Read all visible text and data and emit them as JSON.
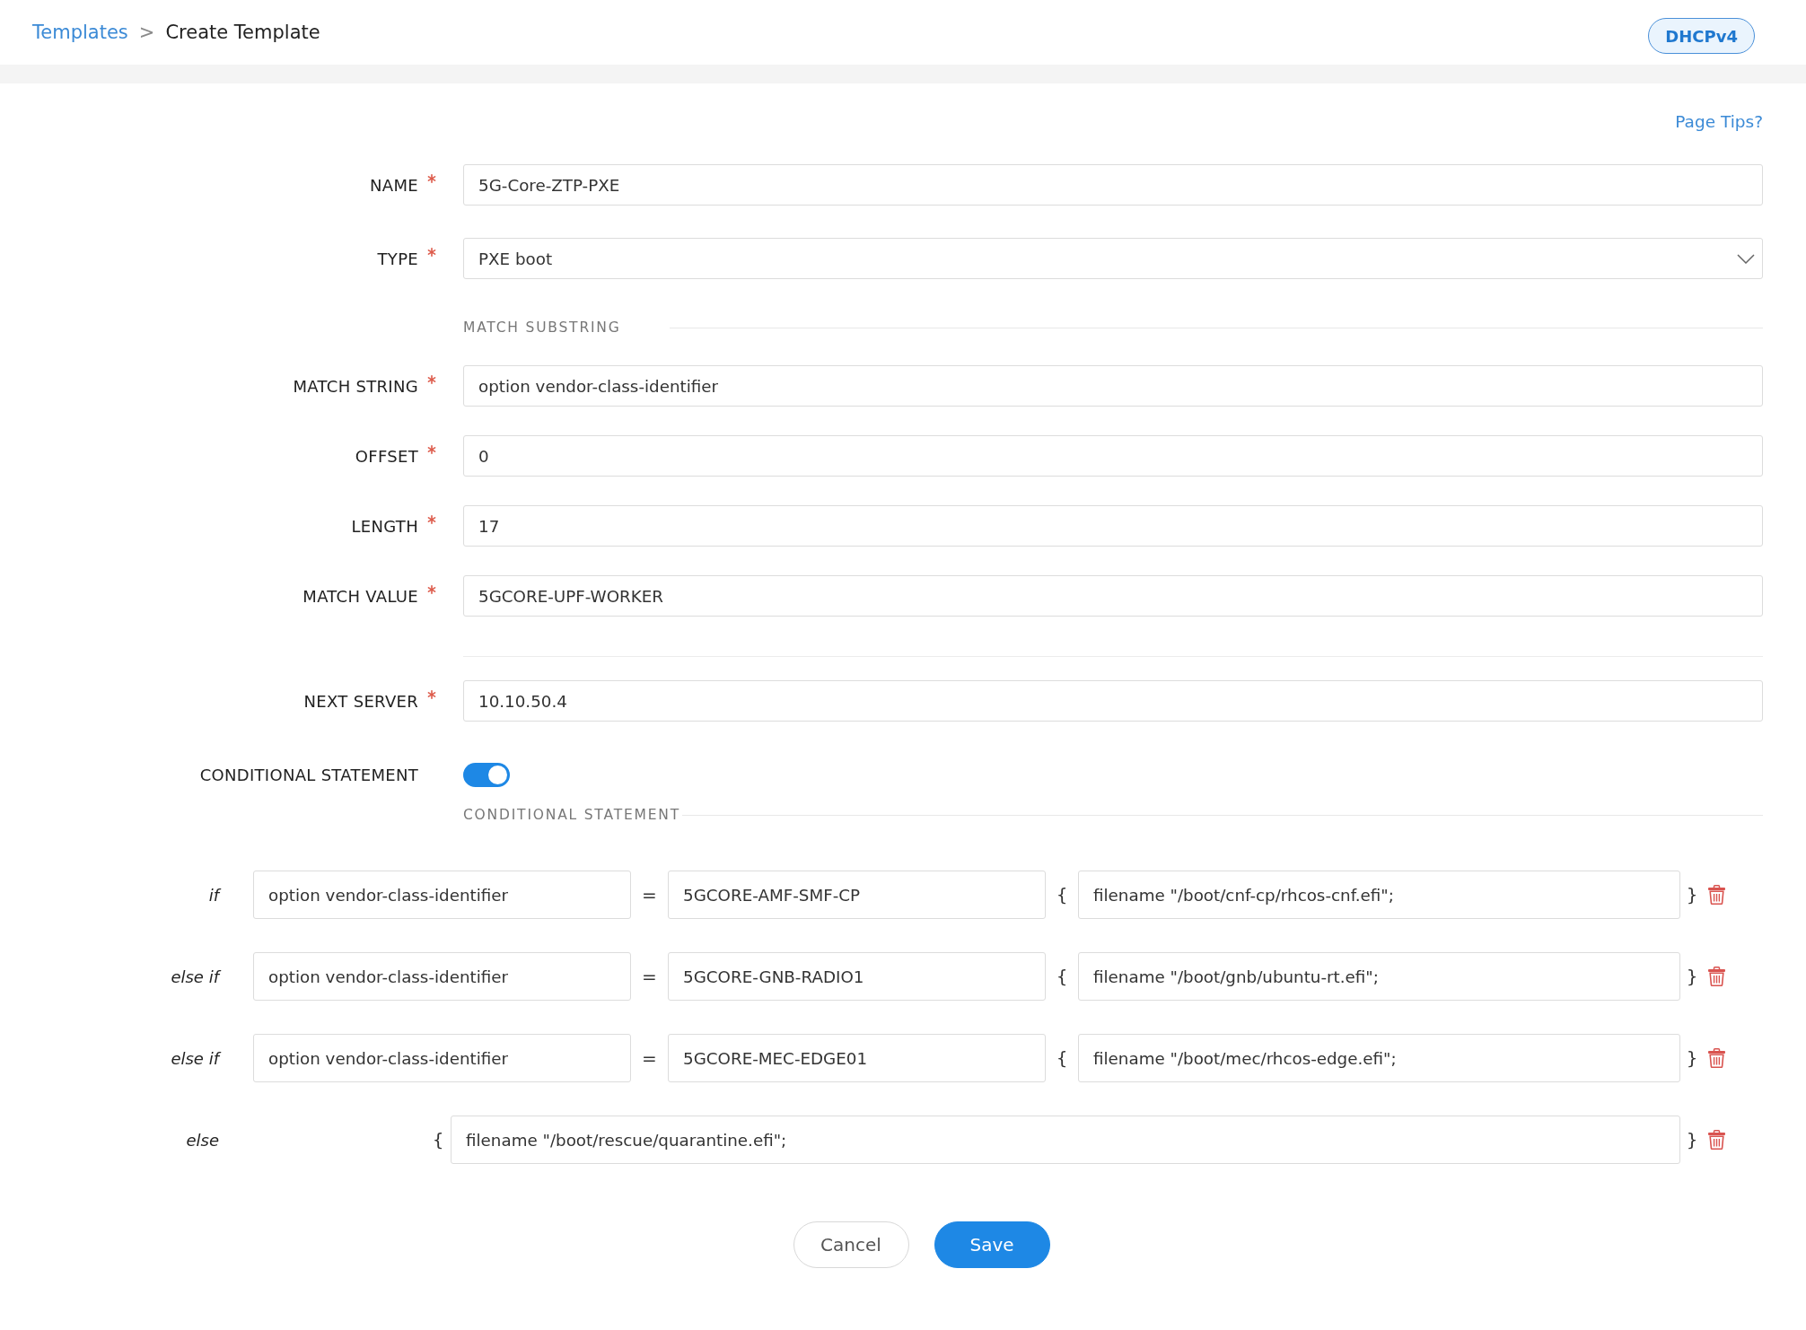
{
  "header": {
    "breadcrumb": [
      {
        "kind": "link",
        "label": "Templates"
      },
      {
        "kind": "separator",
        "label": ">"
      },
      {
        "kind": "current",
        "label": "Create Template"
      }
    ],
    "badge": "DHCPv4"
  },
  "page_tips": "Page Tips?",
  "form": {
    "rows": [
      {
        "kind": "text",
        "label": "NAME",
        "required": true,
        "value": "5G-Core-ZTP-PXE"
      },
      {
        "kind": "select",
        "label": "TYPE",
        "required": true,
        "value": "PXE boot"
      },
      {
        "kind": "section",
        "title": "MATCH SUBSTRING"
      },
      {
        "kind": "text",
        "label": "MATCH STRING",
        "required": true,
        "value": "option vendor-class-identifier"
      },
      {
        "kind": "text",
        "label": "OFFSET",
        "required": true,
        "value": "0"
      },
      {
        "kind": "text",
        "label": "LENGTH",
        "required": true,
        "value": "17"
      },
      {
        "kind": "text",
        "label": "MATCH VALUE",
        "required": true,
        "value": "5GCORE-UPF-WORKER"
      },
      {
        "kind": "divider"
      },
      {
        "kind": "text",
        "label": "NEXT SERVER",
        "required": true,
        "value": "10.10.50.4"
      },
      {
        "kind": "toggle",
        "label": "CONDITIONAL STATEMENT",
        "on": true
      },
      {
        "kind": "section",
        "title": "CONDITIONAL STATEMENT"
      }
    ]
  },
  "conditions": [
    {
      "kind": "condition",
      "keyword": "if",
      "left": "option vendor-class-identifier",
      "operator": "=",
      "right": "5GCORE-AMF-SMF-CP",
      "open": "{",
      "body": "filename \"/boot/cnf-cp/rhcos-cnf.efi\";",
      "close": "}"
    },
    {
      "kind": "condition",
      "keyword": "else if",
      "left": "option vendor-class-identifier",
      "operator": "=",
      "right": "5GCORE-GNB-RADIO1",
      "open": "{",
      "body": "filename \"/boot/gnb/ubuntu-rt.efi\";",
      "close": "}"
    },
    {
      "kind": "condition",
      "keyword": "else if",
      "left": "option vendor-class-identifier",
      "operator": "=",
      "right": "5GCORE-MEC-EDGE01",
      "open": "{",
      "body": "filename \"/boot/mec/rhcos-edge.efi\";",
      "close": "}"
    },
    {
      "kind": "else",
      "keyword": "else",
      "open": "{",
      "body": "filename \"/boot/rescue/quarantine.efi\";",
      "close": "}"
    }
  ],
  "buttons": [
    {
      "kind": "secondary",
      "label": "Cancel"
    },
    {
      "kind": "primary",
      "label": "Save"
    }
  ]
}
